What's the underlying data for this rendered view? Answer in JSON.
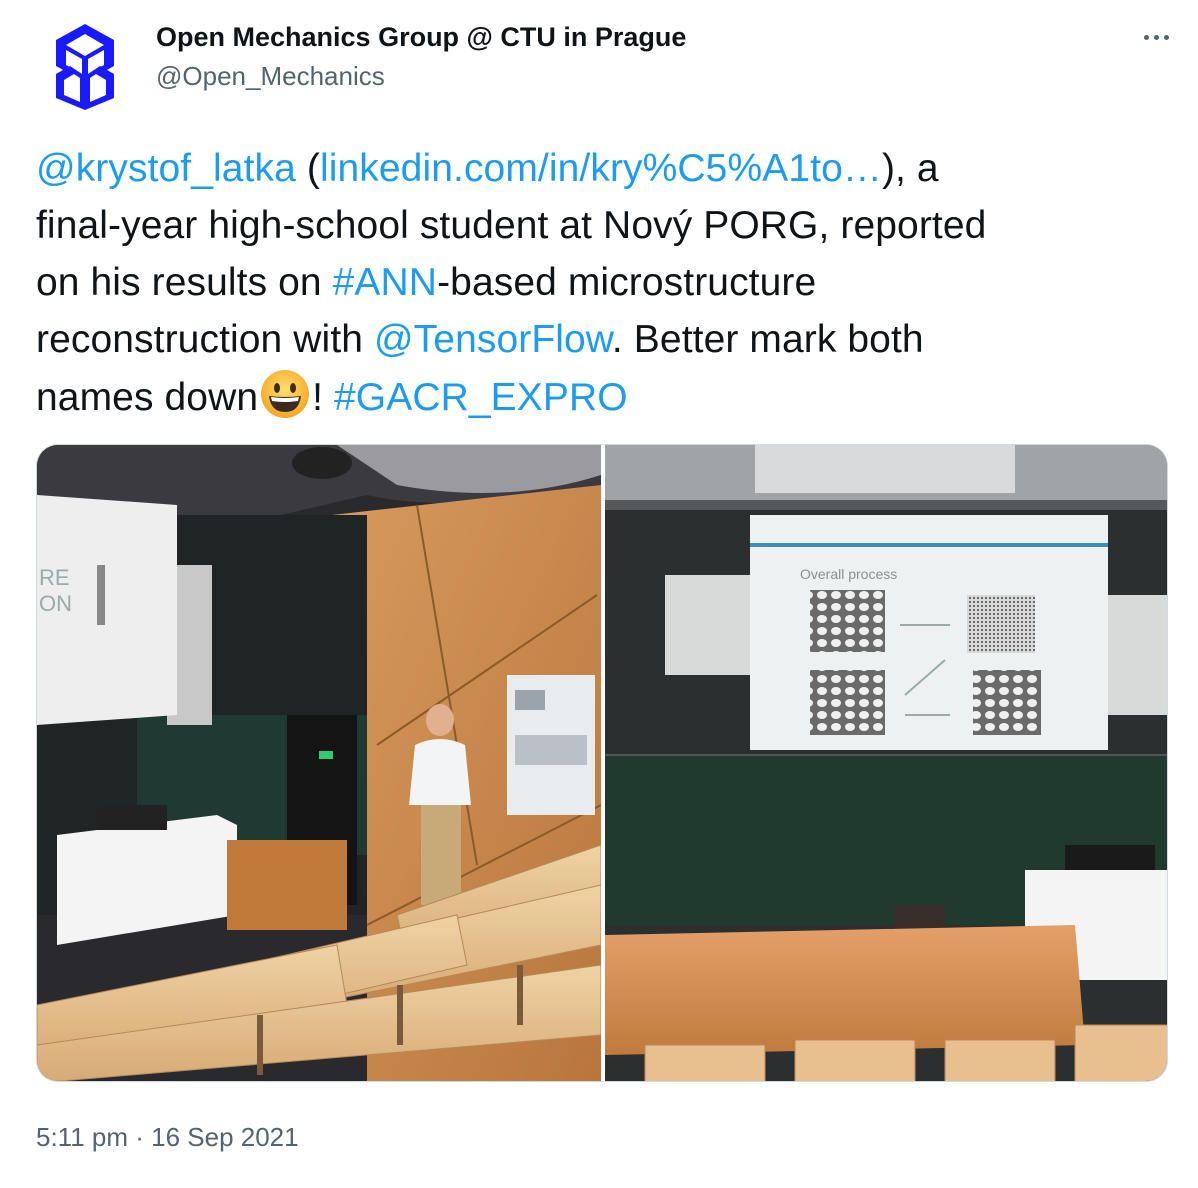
{
  "author": {
    "display_name": "Open Mechanics Group @ CTU in Prague",
    "handle": "@Open_Mechanics",
    "avatar_icon": "cube-logo-icon",
    "avatar_color": "#1a1aff"
  },
  "more_icon": "more-options-icon",
  "tweet": {
    "mention_1": "@krystof_latka",
    "paren_open": " (",
    "link_text": "linkedin.com/in/kry%C5%A1to…",
    "text_1": "), a",
    "text_2": "final-year high-school student at Nový PORG, reported",
    "text_3": "on his results on ",
    "hashtag_1": "#ANN",
    "text_4": "-based microstructure",
    "text_5": "reconstruction with ",
    "mention_2": "@TensorFlow",
    "text_6": ". Better mark both",
    "text_7": "names down",
    "emoji": "grinning-face-emoji",
    "text_8": "! ",
    "hashtag_2": "#GACR_EXPRO"
  },
  "media": {
    "left_photo": {
      "screen_text_line_1": "RE",
      "screen_text_line_2": "ON"
    },
    "right_photo": {
      "slide_title": "Overall process"
    }
  },
  "timestamp": "5:11 pm · 16 Sep 2021",
  "colors": {
    "link": "#1d9bf0",
    "secondary_text": "#536471",
    "border": "#cfd9de"
  }
}
